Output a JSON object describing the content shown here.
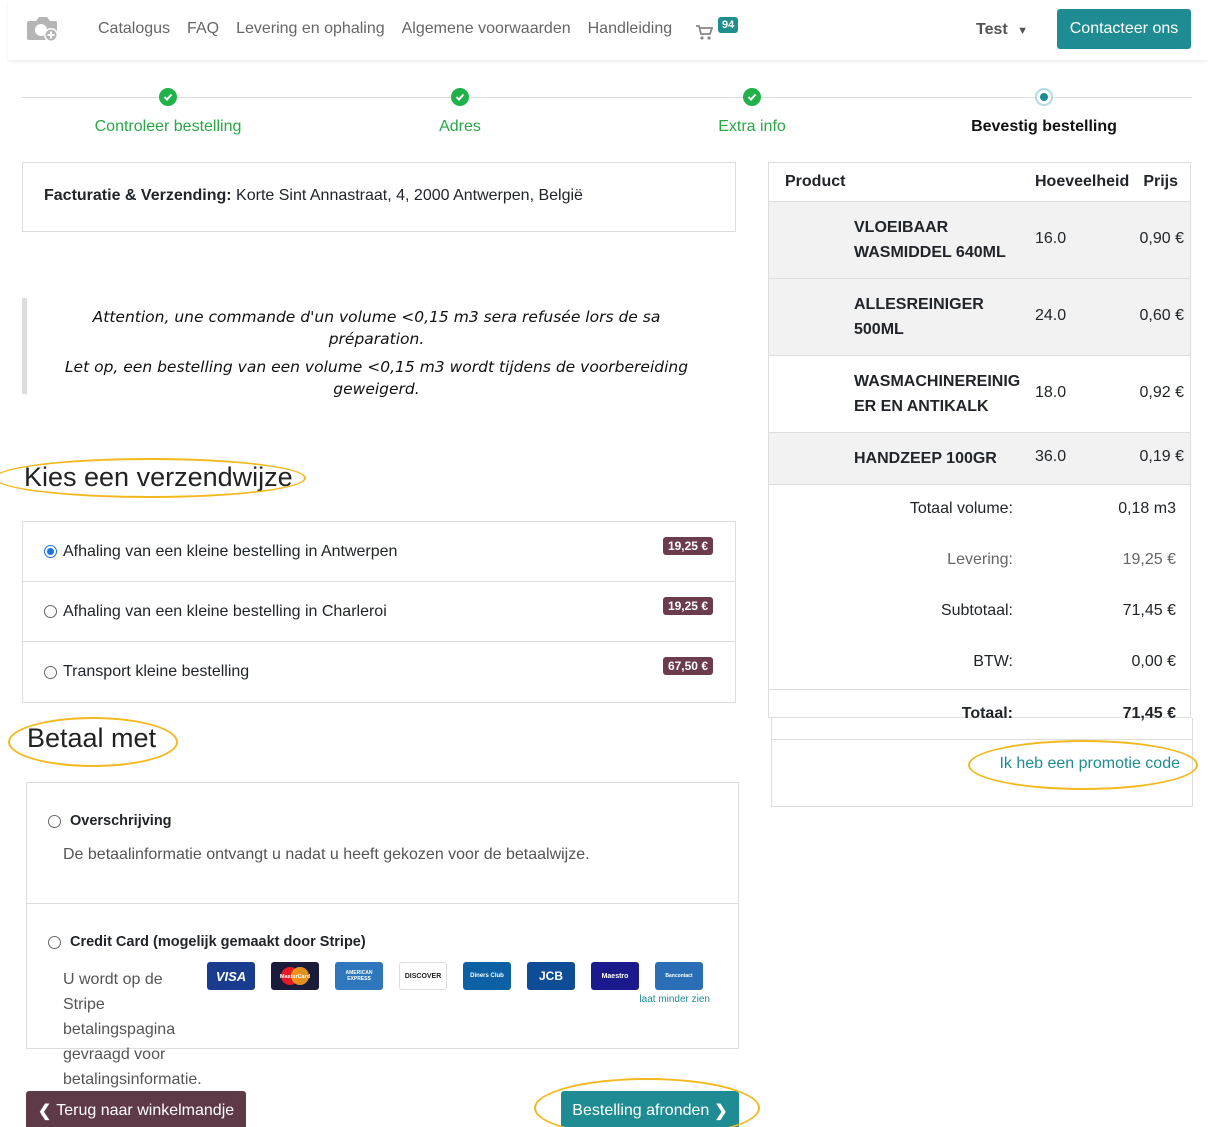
{
  "nav": {
    "links": [
      "Catalogus",
      "FAQ",
      "Levering en ophaling",
      "Algemene voorwaarden",
      "Handleiding"
    ],
    "cart_count": "94",
    "user": "Test",
    "contact_label": "Contacteer ons"
  },
  "steps": [
    {
      "label": "Controleer bestelling",
      "state": "done"
    },
    {
      "label": "Adres",
      "state": "done"
    },
    {
      "label": "Extra info",
      "state": "done"
    },
    {
      "label": "Bevestig bestelling",
      "state": "current"
    }
  ],
  "address": {
    "label": "Facturatie & Verzending:",
    "value": "Korte Sint Annastraat, 4, 2000 Antwerpen, België"
  },
  "notice": {
    "fr": "Attention, une commande d'un volume <0,15 m3 sera refusée lors de sa préparation.",
    "nl": "Let op, een bestelling van een volume <0,15 m3 wordt tijdens de voorbereiding geweigerd."
  },
  "shipping": {
    "heading": "Kies een verzendwijze",
    "options": [
      {
        "label": "Afhaling van een kleine bestelling in Antwerpen",
        "price": "19,25 €",
        "selected": true
      },
      {
        "label": "Afhaling van een kleine bestelling in Charleroi",
        "price": "19,25 €",
        "selected": false
      },
      {
        "label": "Transport kleine bestelling",
        "price": "67,50 €",
        "selected": false
      }
    ]
  },
  "payment": {
    "heading": "Betaal met",
    "methods": [
      {
        "title": "Overschrijving",
        "description": "De betaalinformatie ontvangt u nadat u heeft gekozen voor de betaalwijze."
      },
      {
        "title": "Credit Card (mogelijk gemaakt door Stripe)",
        "description": "U wordt op de Stripe betalingspagina gevraagd voor betalingsinformatie."
      }
    ],
    "cards": [
      "VISA",
      "MasterCard",
      "AMERICAN EXPRESS",
      "DISCOVER",
      "Diners Club",
      "JCB",
      "Maestro",
      "Bancontact"
    ],
    "show_less": "laat minder zien"
  },
  "order": {
    "headers": {
      "product": "Product",
      "qty": "Hoeveelheid",
      "price": "Prijs"
    },
    "items": [
      {
        "name": "VLOEIBAAR WASMIDDEL 640ML",
        "qty": "16.0",
        "price": "0,90 €"
      },
      {
        "name": "ALLESREINIGER 500ML",
        "qty": "24.0",
        "price": "0,60 €"
      },
      {
        "name": "WASMACHINEREINIGER EN ANTIKALK",
        "qty": "18.0",
        "price": "0,92 €"
      },
      {
        "name": "HANDZEEP 100GR",
        "qty": "36.0",
        "price": "0,19 €"
      }
    ],
    "totals": {
      "volume_label": "Totaal volume:",
      "volume": "0,18 m3",
      "delivery_label": "Levering:",
      "delivery": "19,25 €",
      "subtotal_label": "Subtotaal:",
      "subtotal": "71,45 €",
      "vat_label": "BTW:",
      "vat": "0,00 €",
      "total_label": "Totaal:",
      "total": "71,45 €"
    },
    "promo_link": "Ik heb een promotie code"
  },
  "buttons": {
    "back": "Terug naar winkelmandje",
    "finish": "Bestelling afronden"
  },
  "colors": {
    "primary": "#1e8c92",
    "secondary": "#5e3a48",
    "success": "#21b14b",
    "highlight": "#f2b81e"
  }
}
